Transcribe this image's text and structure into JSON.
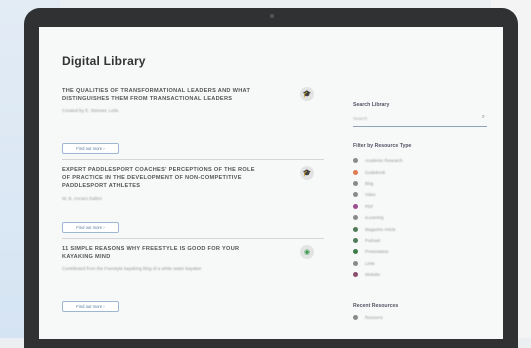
{
  "app": {
    "title": "Digital Library"
  },
  "articles": [
    {
      "title": "The Qualities of Transformational Leaders and What Distinguishes Them from Transactional Leaders",
      "meta": "Created by E. Stenner, Leila",
      "button_label": "Find out more ›",
      "icon": "graduation-cap-icon"
    },
    {
      "title": "Expert paddlesport coaches' perceptions of the role of practice in the development of non-competitive paddlesport athletes",
      "meta": "W. B. Ancaro Dalimi",
      "button_label": "Find out more ›",
      "icon": "graduation-cap-icon"
    },
    {
      "title": "11 Simple Reasons Why Freestyle Is Good For Your Kayaking Mind",
      "meta": "Contributed from the Freestyle kayaking blog of a white water kayaker",
      "button_label": "Find out more ›",
      "icon": "rss-icon"
    }
  ],
  "sidebar": {
    "search_heading": "Search Library",
    "search_placeholder": "Search",
    "filter_heading": "Filter by Resource Type",
    "filters": [
      {
        "label": "Academic Research",
        "color": "#8a8a8a"
      },
      {
        "label": "Guidebook",
        "color": "#e07a4f"
      },
      {
        "label": "Blog",
        "color": "#8a8a8a"
      },
      {
        "label": "Video",
        "color": "#8a8a8a"
      },
      {
        "label": "PDF",
        "color": "#9b4f8e"
      },
      {
        "label": "eLearning",
        "color": "#8a8a8a"
      },
      {
        "label": "Magazine Article",
        "color": "#4f7b57"
      },
      {
        "label": "Podcast",
        "color": "#4f7b57"
      },
      {
        "label": "Presentation",
        "color": "#3f7a4a"
      },
      {
        "label": "Links",
        "color": "#8a8a8a"
      },
      {
        "label": "Website",
        "color": "#8a4f6e"
      }
    ],
    "recent_heading": "Recent Resources",
    "recent_items": [
      {
        "label": "Resource"
      }
    ]
  }
}
